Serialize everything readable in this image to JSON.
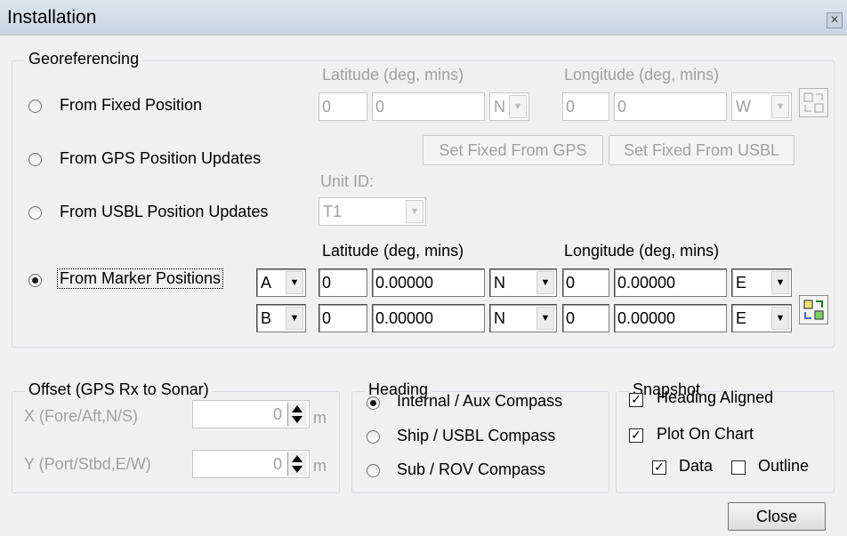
{
  "window": {
    "title": "Installation"
  },
  "georef": {
    "legend": "Georeferencing",
    "lat_header_disabled": "Latitude (deg, mins)",
    "lon_header_disabled": "Longitude (deg, mins)",
    "opt_fixed": "From Fixed Position",
    "opt_gps": "From GPS Position Updates",
    "opt_usbl": "From USBL Position Updates",
    "opt_marker": "From Marker Positions",
    "selected": "From Marker Positions",
    "fixed": {
      "lat_deg": "0",
      "lat_min": "0",
      "lat_hemi": "N",
      "lon_deg": "0",
      "lon_min": "0",
      "lon_hemi": "W"
    },
    "set_fixed_gps": "Set Fixed From GPS",
    "set_fixed_usbl": "Set Fixed From USBL",
    "unit_id_label": "Unit ID:",
    "unit_id": "T1",
    "lat_header": "Latitude (deg, mins)",
    "lon_header": "Longitude (deg, mins)",
    "markers": [
      {
        "marker": "A",
        "lat_deg": "0",
        "lat_min": "0.00000",
        "lat_hemi": "N",
        "lon_deg": "0",
        "lon_min": "0.00000",
        "lon_hemi": "E"
      },
      {
        "marker": "B",
        "lat_deg": "0",
        "lat_min": "0.00000",
        "lat_hemi": "N",
        "lon_deg": "0",
        "lon_min": "0.00000",
        "lon_hemi": "E"
      }
    ]
  },
  "offset": {
    "legend": "Offset (GPS Rx to Sonar)",
    "x_label": "X (Fore/Aft,N/S)",
    "x_value": "0",
    "x_unit": "m",
    "y_label": "Y (Port/Stbd,E/W)",
    "y_value": "0",
    "y_unit": "m"
  },
  "heading": {
    "legend": "Heading",
    "opt_internal": "Internal / Aux Compass",
    "opt_ship": "Ship / USBL Compass",
    "opt_sub": "Sub / ROV Compass",
    "selected": "Internal / Aux Compass"
  },
  "snapshot": {
    "legend": "Snapshot",
    "heading_aligned": "Heading Aligned",
    "heading_aligned_checked": true,
    "plot_on_chart": "Plot On Chart",
    "plot_on_chart_checked": true,
    "data": "Data",
    "data_checked": true,
    "outline": "Outline",
    "outline_checked": false
  },
  "close_label": "Close"
}
